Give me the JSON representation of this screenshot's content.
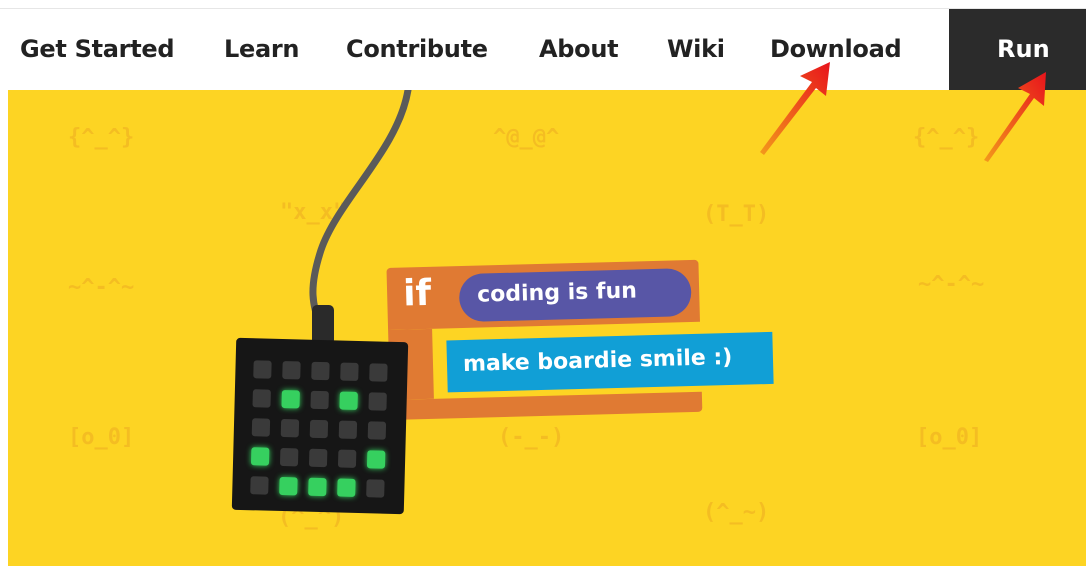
{
  "nav": {
    "items": [
      {
        "label": "Get Started"
      },
      {
        "label": "Learn"
      },
      {
        "label": "Contribute"
      },
      {
        "label": "About"
      },
      {
        "label": "Wiki"
      },
      {
        "label": "Download"
      }
    ],
    "run_label": "Run"
  },
  "hero": {
    "block_if_keyword": "if",
    "block_condition": "coding is fun",
    "block_action": "make boardie smile :)",
    "emoticons": [
      "{^_^}",
      "^@_@^",
      "{^_^}",
      "\"x_x\"",
      "(T_T)",
      "~^-^~",
      "~^-^~",
      "[o_0]",
      "(-_-)",
      "[o_0]",
      "(^_~)",
      "(^_^)"
    ]
  },
  "colors": {
    "hero_bg": "#fdd423",
    "if_block": "#e07a33",
    "condition_pill": "#5856a6",
    "action_block": "#119fd6",
    "led_on": "#36d05f",
    "led_off": "#3a3a3a",
    "run_bg": "#2b2b2b"
  }
}
